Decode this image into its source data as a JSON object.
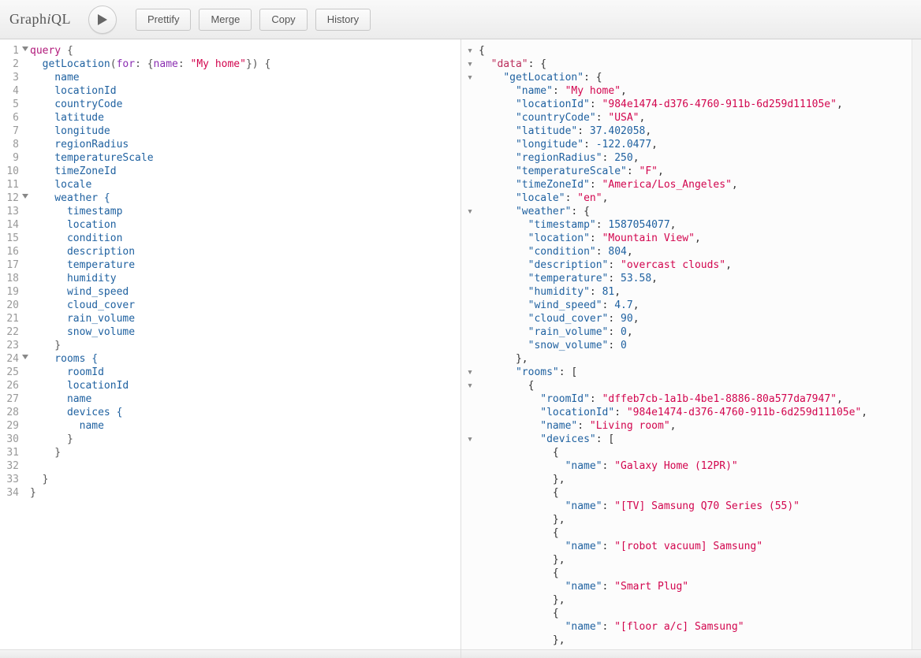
{
  "app": {
    "title": "GraphiQL"
  },
  "toolbar": {
    "prettify": "Prettify",
    "merge": "Merge",
    "copy": "Copy",
    "history": "History"
  },
  "editor": {
    "lineCount": 34,
    "foldLines": [
      1,
      12,
      24
    ],
    "text": {
      "l1": "query {",
      "l2a": "  getLocation(",
      "l2b": "for",
      "l2c": ": {",
      "l2d": "name",
      "l2e": ": ",
      "l2f": "\"My home\"",
      "l2g": "}) {",
      "l3": "    name",
      "l4": "    locationId",
      "l5": "    countryCode",
      "l6": "    latitude",
      "l7": "    longitude",
      "l8": "    regionRadius",
      "l9": "    temperatureScale",
      "l10": "    timeZoneId",
      "l11": "    locale",
      "l12": "    weather {",
      "l13": "      timestamp",
      "l14": "      location",
      "l15": "      condition",
      "l16": "      description",
      "l17": "      temperature",
      "l18": "      humidity",
      "l19": "      wind_speed",
      "l20": "      cloud_cover",
      "l21": "      rain_volume",
      "l22": "      snow_volume",
      "l23": "    }",
      "l24": "    rooms {",
      "l25": "      roomId",
      "l26": "      locationId",
      "l27": "      name",
      "l28": "      devices {",
      "l29": "        name",
      "l30": "      }",
      "l31": "    }",
      "l32": "",
      "l33": "  }",
      "l34": "}"
    }
  },
  "result": {
    "data": {
      "getLocation": {
        "name": "My home",
        "locationId": "984e1474-d376-4760-911b-6d259d11105e",
        "countryCode": "USA",
        "latitude": 37.402058,
        "longitude": -122.0477,
        "regionRadius": 250,
        "temperatureScale": "F",
        "timeZoneId": "America/Los_Angeles",
        "locale": "en",
        "weather": {
          "timestamp": 1587054077,
          "location": "Mountain View",
          "condition": 804,
          "description": "overcast clouds",
          "temperature": 53.58,
          "humidity": 81,
          "wind_speed": 4.7,
          "cloud_cover": 90,
          "rain_volume": 0,
          "snow_volume": 0
        },
        "rooms": [
          {
            "roomId": "dffeb7cb-1a1b-4be1-8886-80a577da7947",
            "locationId": "984e1474-d376-4760-911b-6d259d11105e",
            "name": "Living room",
            "devices": [
              {
                "name": "Galaxy Home (12PR)"
              },
              {
                "name": "[TV] Samsung Q70 Series (55)"
              },
              {
                "name": "[robot vacuum] Samsung"
              },
              {
                "name": "Smart Plug"
              },
              {
                "name": "[floor a/c] Samsung"
              }
            ]
          }
        ]
      }
    }
  },
  "resultLabels": {
    "data": "data",
    "getLocation": "getLocation",
    "name": "name",
    "locationId": "locationId",
    "countryCode": "countryCode",
    "latitude": "latitude",
    "longitude": "longitude",
    "regionRadius": "regionRadius",
    "temperatureScale": "temperatureScale",
    "timeZoneId": "timeZoneId",
    "locale": "locale",
    "weather": "weather",
    "timestamp": "timestamp",
    "location": "location",
    "condition": "condition",
    "description": "description",
    "temperature": "temperature",
    "humidity": "humidity",
    "wind_speed": "wind_speed",
    "cloud_cover": "cloud_cover",
    "rain_volume": "rain_volume",
    "snow_volume": "snow_volume",
    "rooms": "rooms",
    "roomId": "roomId",
    "devices": "devices"
  }
}
